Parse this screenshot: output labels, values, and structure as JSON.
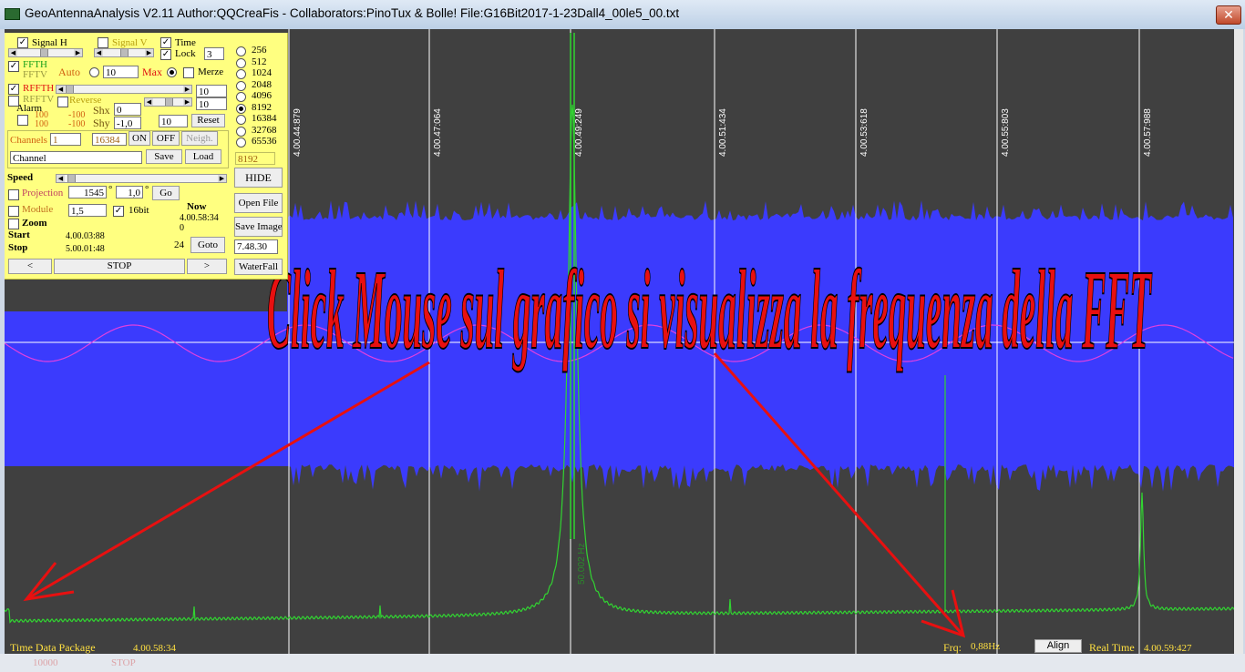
{
  "window": {
    "title": "GeoAntennaAnalysis V2.11 Author:QQCreaFis - Collaborators:PinoTux & Bolle!     File:G16Bit2017-1-23Dall4_00le5_00.txt",
    "close_glyph": "✕",
    "icon": "app-waveform-icon"
  },
  "panel": {
    "signal_h": "Signal H",
    "signal_v": "Signal V",
    "time": "Time",
    "lock": "Lock",
    "lock_value": "3",
    "ffth": "FFTH",
    "fftv": "FFTV",
    "auto": "Auto",
    "auto_value": "10",
    "max": "Max",
    "merze": "Merze",
    "rffth": "RFFTH",
    "rfftv": "RFFTV",
    "reverse": "Reverse",
    "rfft_value1": "10",
    "rfft_value2": "10",
    "alarm": "Alarm",
    "alarm_top": "100",
    "alarm_bottom": "100",
    "neg_top": "-100",
    "neg_bottom": "-100",
    "shx": "Shx",
    "shy": "Shy",
    "shx_value": "0",
    "shy_value": "-1,0",
    "reset_value": "10",
    "reset": "Reset",
    "channels": "Channels",
    "channels_value": "1",
    "channels_count": "16384",
    "on": "ON",
    "off": "OFF",
    "neigh": "Neigh.",
    "channel_name": "Channel",
    "save": "Save",
    "load": "Load",
    "speed": "Speed",
    "projection": "Projection",
    "projection_value": "1545",
    "degree_symbol": "°",
    "projection_angle": "1,0",
    "go": "Go",
    "module": "Module",
    "module_value": "1,5",
    "bit16": "16bit",
    "zoom": "Zoom",
    "now": "Now",
    "now_value": "4.00.58:34",
    "now_zero": "0",
    "start": "Start",
    "start_value": "4.00.03:88",
    "stop_label": "Stop",
    "stop_value": "5.00.01:48",
    "goto_num": "24",
    "goto": "Goto",
    "goto_value": "7.48.30",
    "prev": "<",
    "stop_button": "STOP",
    "next": ">",
    "fft_sizes": [
      "256",
      "512",
      "1024",
      "2048",
      "4096",
      "8192",
      "16384",
      "32768",
      "65536"
    ],
    "fft_selected_index": 5,
    "fft_current": "8192",
    "hide": "HIDE",
    "open_file": "Open File",
    "save_image": "Save Image",
    "waterfall": "WaterFall"
  },
  "plot": {
    "time_markers": [
      "4.00.44:879",
      "4.00.47:064",
      "4.00.49:249",
      "4.00.51:434",
      "4.00.53:618",
      "4.00.55:803",
      "4.00.57:988"
    ],
    "rotated_freq_label": "50.002 Hz",
    "overlay_caption": "Click Mouse sul grafico si visualizza la frequenza della FFT",
    "colors": {
      "background": "#404040",
      "signal_band": "#3b3bfd",
      "fft_trace": "#31d431",
      "sine": "#e040e0",
      "grid": "#ffffff",
      "arrow": "#e81010",
      "panel": "#ffff80"
    }
  },
  "status": {
    "time_data_package": "Time Data Package",
    "time_value": "4.00.58:34",
    "frq_label": "Frq:",
    "frq_value": "0,88Hz",
    "align": "Align",
    "real_time": "Real Time",
    "real_time_value": "4.00.59:427"
  },
  "ghost_bottom": {
    "value": "10000",
    "stop": "STOP"
  }
}
